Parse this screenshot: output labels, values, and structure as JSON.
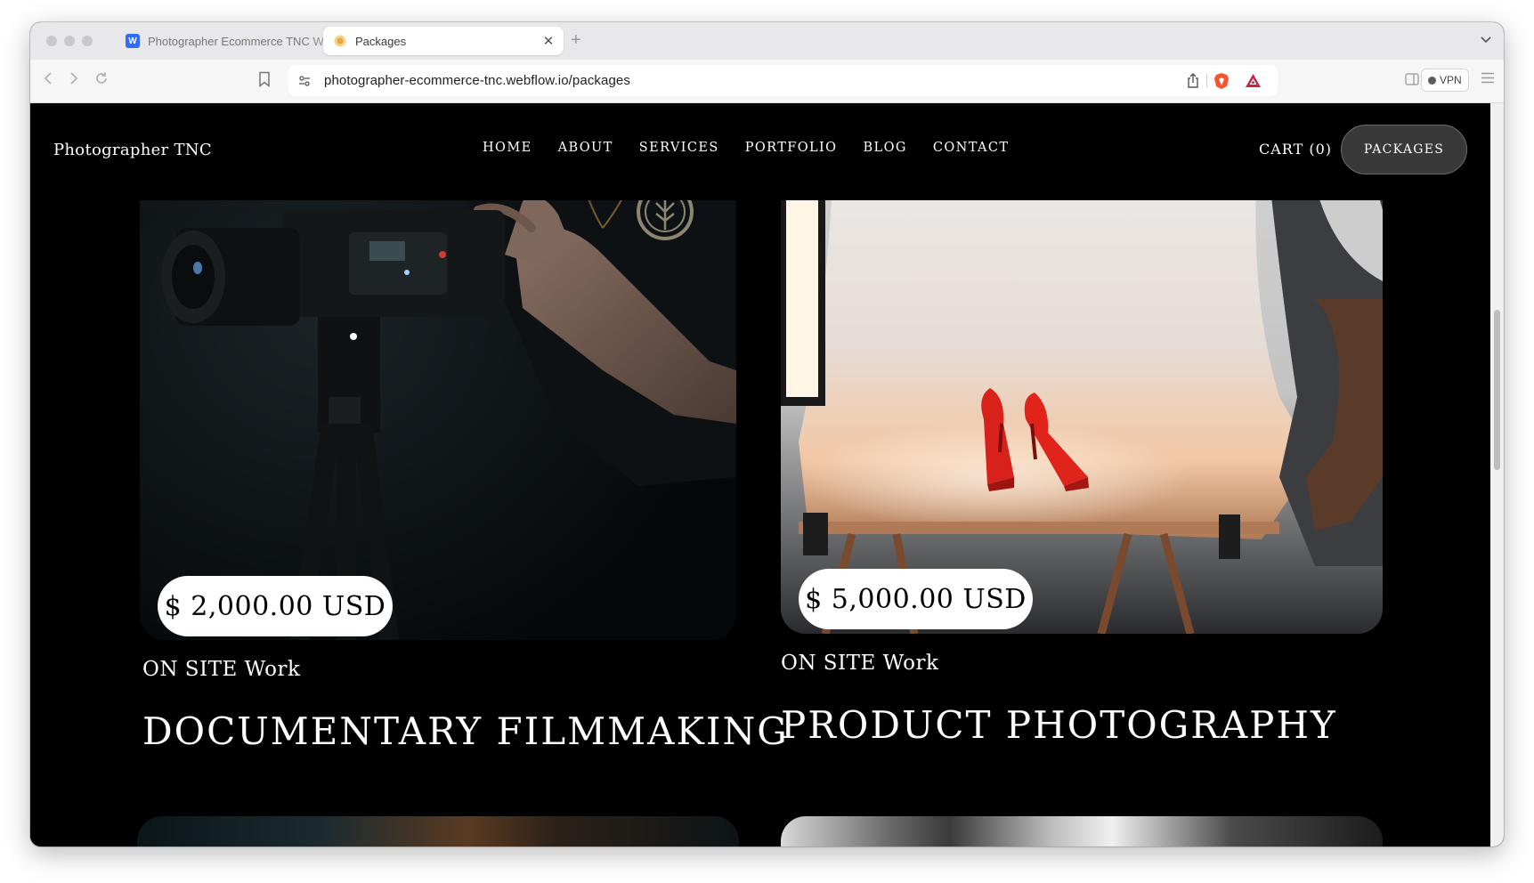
{
  "browser": {
    "tabs": [
      {
        "label": "Photographer Ecommerce TNC Webflow",
        "active": false,
        "favicon_color": "#2f6bff"
      },
      {
        "label": "Packages",
        "active": true,
        "favicon_color": "#e7b84a"
      }
    ],
    "new_tab_glyph": "+",
    "url": "photographer-ecommerce-tnc.webflow.io/packages",
    "vpn_label": "VPN"
  },
  "site": {
    "logo": "Photographer TNC",
    "nav": [
      "HOME",
      "ABOUT",
      "SERVICES",
      "PORTFOLIO",
      "BLOG",
      "CONTACT"
    ],
    "cart_label": "CART",
    "cart_count": "(0)",
    "packages_button": "PACKAGES"
  },
  "packages": [
    {
      "price": "$ 2,000.00 USD",
      "kicker": "ON SITE Work",
      "title": "DOCUMENTARY FILMMAKING",
      "image": "camera-operator-photo"
    },
    {
      "price": "$ 5,000.00 USD",
      "kicker": "ON SITE Work",
      "title": "PRODUCT PHOTOGRAPHY",
      "image": "red-heels-studio-photo"
    }
  ],
  "colors": {
    "page_bg": "#000000",
    "accent_shoe": "#d9211b",
    "button_bg": "#393939"
  }
}
